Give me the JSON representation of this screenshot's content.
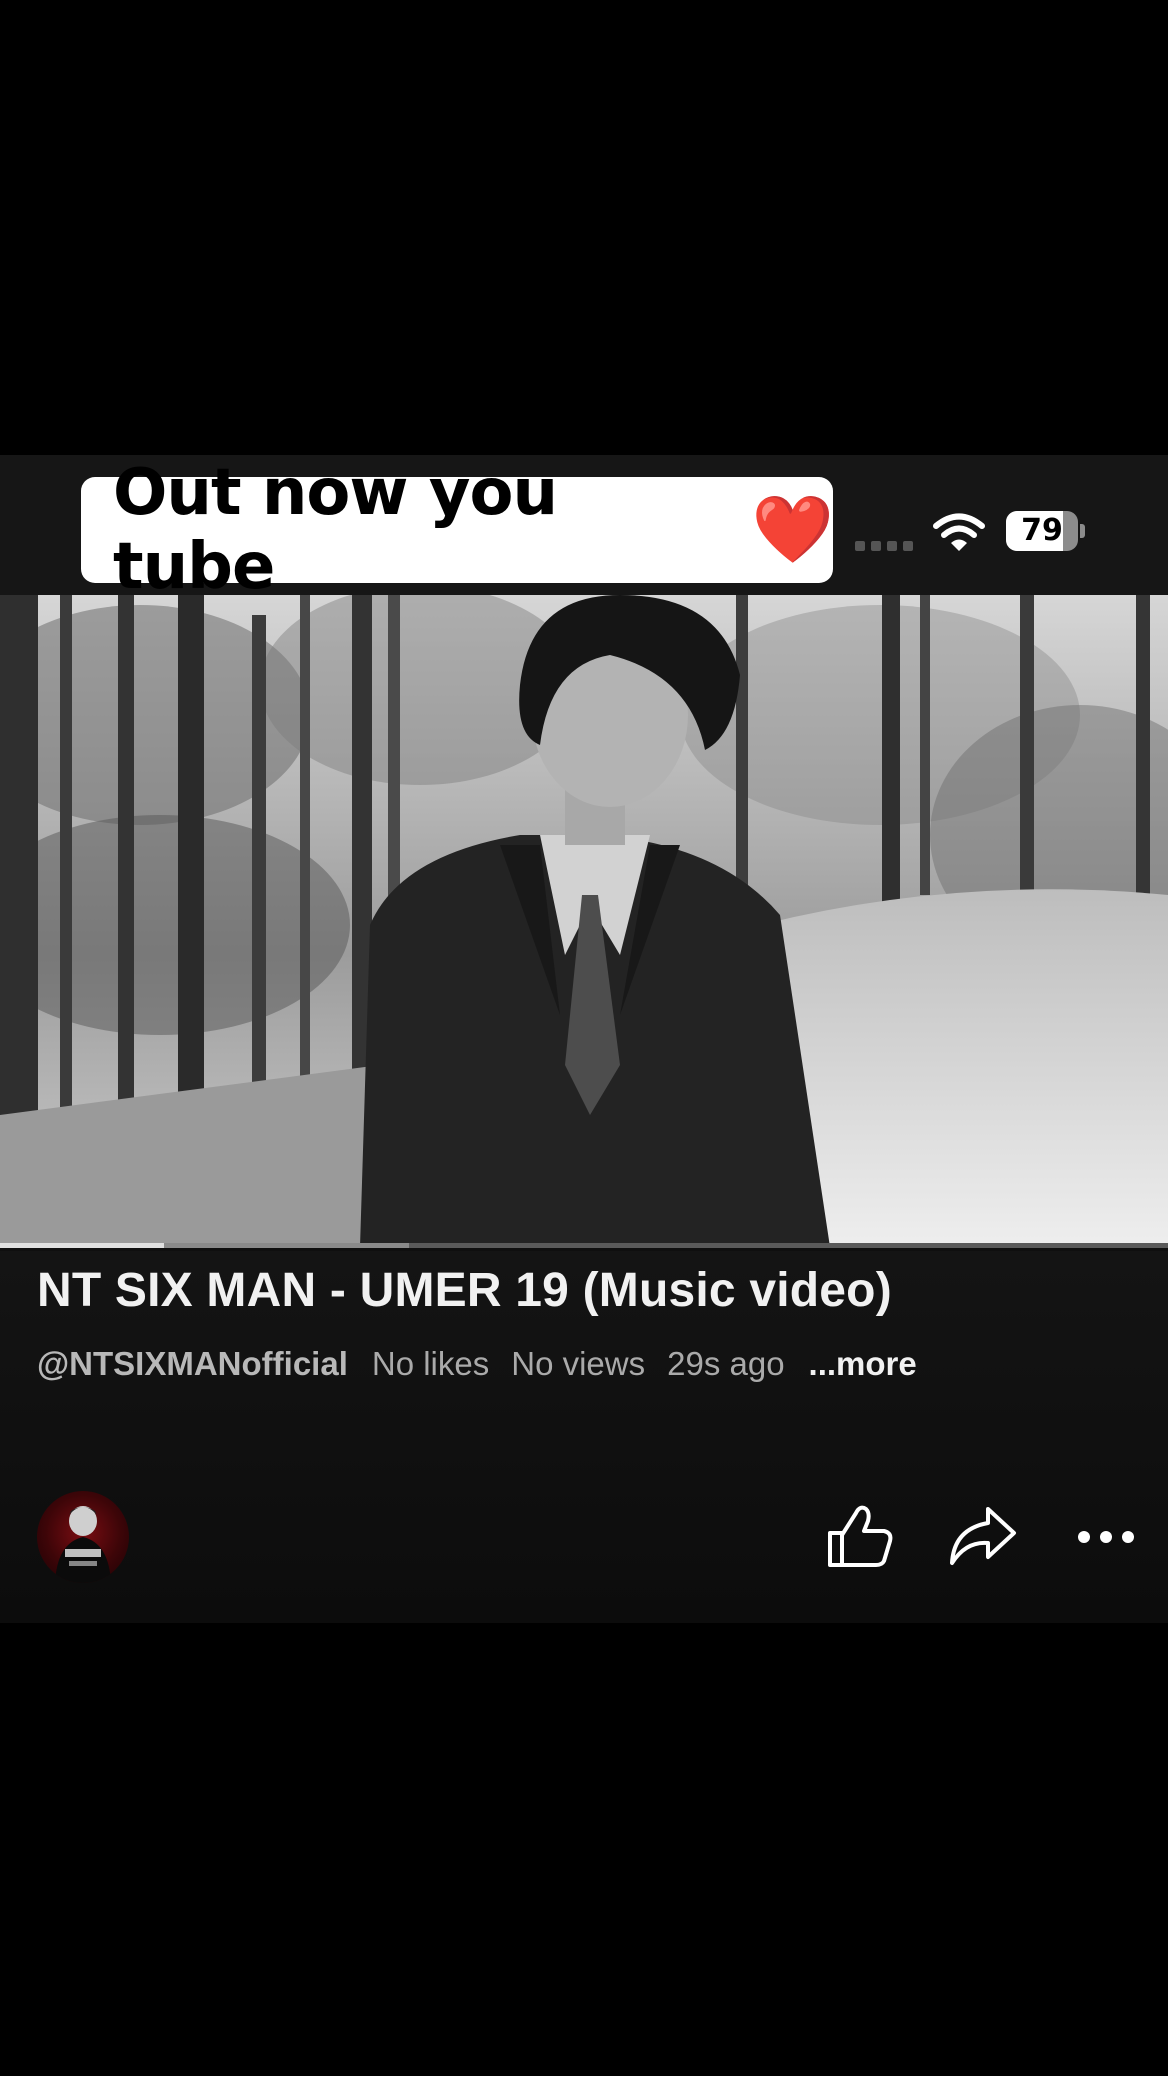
{
  "overlay_caption": {
    "text": "Out now you tube",
    "emoji": "❤️"
  },
  "status_bar": {
    "battery_level": "79",
    "battery_fraction": 0.79,
    "wifi_icon": "wifi-icon",
    "signal_icon": "cellular-dots-icon"
  },
  "player": {
    "played_fraction": 0.14,
    "buffered_fraction": 0.35
  },
  "video_info": {
    "title": "NT SIX MAN - UMER 19 (Music video)",
    "channel_handle": "@NTSIXMANofficial",
    "likes": "No likes",
    "views": "No views",
    "age": "29s ago",
    "more_label": "...more"
  },
  "actions": {
    "like_icon": "thumbs-up-icon",
    "share_icon": "share-arrow-icon",
    "more_icon": "more-dots-icon"
  },
  "colors": {
    "background": "#000000",
    "panel": "#0f0f0f",
    "caption_bg": "#ffffff",
    "heart": "#e8112d",
    "text_primary": "#f1f1f1",
    "text_secondary": "#aaaaaa"
  }
}
